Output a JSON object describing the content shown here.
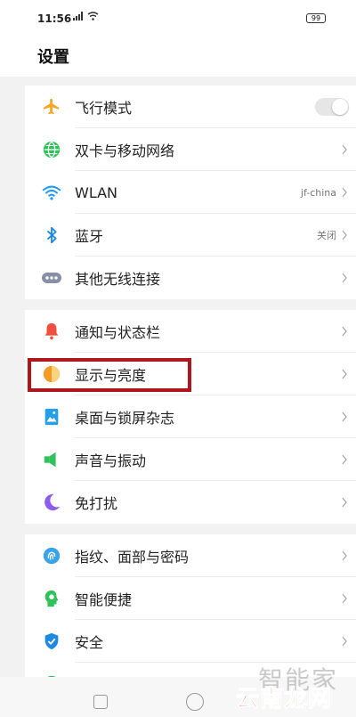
{
  "status_bar": {
    "time": "11:56",
    "battery": "99"
  },
  "header": {
    "title": "设置"
  },
  "groups": [
    {
      "items": [
        {
          "label": "飞行模式",
          "icon": "airplane-icon",
          "control": "toggle",
          "toggle_on": false
        },
        {
          "label": "双卡与移动网络",
          "icon": "globe-icon"
        },
        {
          "label": "WLAN",
          "icon": "wifi-icon",
          "value": "jf-china"
        },
        {
          "label": "蓝牙",
          "icon": "bluetooth-icon",
          "value": "关闭"
        },
        {
          "label": "其他无线连接",
          "icon": "more-dots-icon"
        }
      ]
    },
    {
      "items": [
        {
          "label": "通知与状态栏",
          "icon": "bell-icon"
        },
        {
          "label": "显示与亮度",
          "icon": "brightness-icon",
          "highlighted": true
        },
        {
          "label": "桌面与锁屏杂志",
          "icon": "wallpaper-icon"
        },
        {
          "label": "声音与振动",
          "icon": "speaker-icon"
        },
        {
          "label": "免打扰",
          "icon": "moon-icon"
        }
      ]
    },
    {
      "items": [
        {
          "label": "指纹、面部与密码",
          "icon": "fingerprint-icon"
        },
        {
          "label": "智能便捷",
          "icon": "smart-assist-icon"
        },
        {
          "label": "安全",
          "icon": "shield-icon"
        }
      ]
    }
  ],
  "watermark": {
    "top": "智能家",
    "bottom": "云南龙网"
  },
  "colors": {
    "highlight_border": "#b0141c",
    "airplane": "#f5a623",
    "globe": "#2fc25b",
    "wifi": "#1e9bf0",
    "bluetooth": "#1e88e5",
    "more": "#8a8fa8",
    "bell": "#f04e3e",
    "brightness": "#f59a23",
    "wallpaper": "#23a0e8",
    "speaker": "#2fc25b",
    "moon": "#8c5cf0",
    "fingerprint": "#3aa4e8",
    "smart": "#2fc25b",
    "shield": "#1e88e5"
  }
}
